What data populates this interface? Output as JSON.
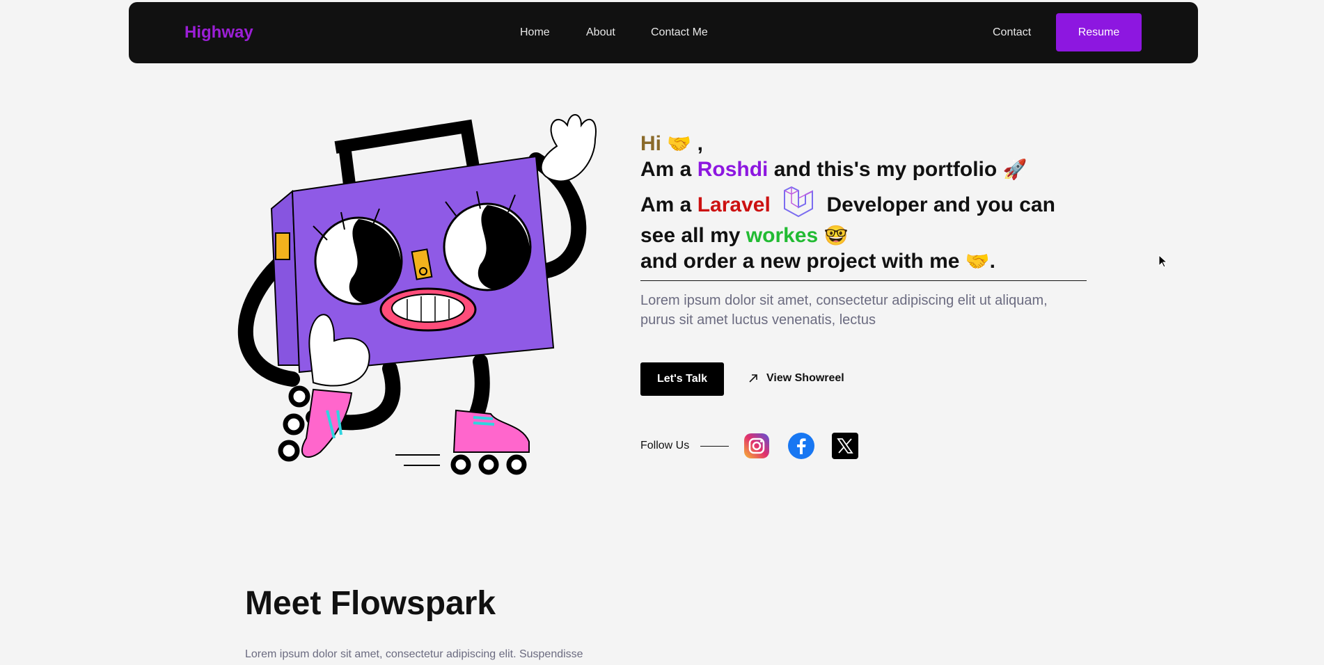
{
  "nav": {
    "brand": "Highway",
    "links": [
      "Home",
      "About",
      "Contact Me"
    ],
    "contact": "Contact",
    "resume": "Resume"
  },
  "hero": {
    "greeting_hi": "Hi",
    "greeting_emoji": "🤝",
    "greeting_comma": ",",
    "line2_prefix": "Am a",
    "line2_name": "Roshdi",
    "line2_suffix": "and this's my portfolio",
    "line2_emoji": "🚀",
    "line3_prefix": "Am a",
    "line3_tech": "Laravel",
    "line3_suffix": "Developer and you can",
    "line4_prefix": "see all my",
    "line4_word": "workes",
    "line4_emoji": "🤓",
    "line5_text": "and order a new project with me",
    "line5_emoji": "🤝",
    "line5_end": ".",
    "description": "Lorem ipsum dolor sit amet, consectetur adipiscing elit ut aliquam, purus sit amet luctus venenatis, lectus",
    "talk_button": "Let's Talk",
    "showreel_link": "View Showreel",
    "follow_label": "Follow Us",
    "social": [
      "instagram-icon",
      "facebook-icon",
      "x-icon"
    ]
  },
  "section": {
    "title": "Meet Flowspark",
    "text": "Lorem ipsum dolor sit amet, consectetur adipiscing elit. Suspendisse"
  },
  "colors": {
    "brand": "#9b1fd6",
    "accent": "#8d17e0",
    "laravel": "#cc1111",
    "workes": "#22bb33",
    "hi": "#8a6a2a"
  }
}
